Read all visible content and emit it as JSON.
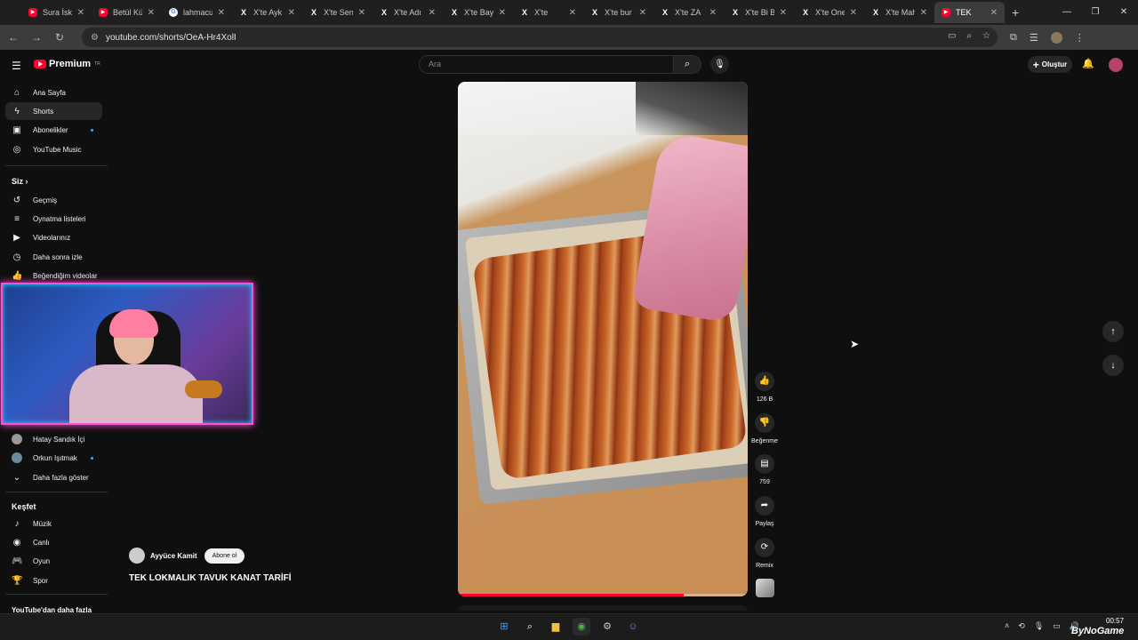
{
  "browser": {
    "tabs": [
      {
        "label": "Sura İska",
        "icon": "youtube-icon"
      },
      {
        "label": "Betül Kü",
        "icon": "youtube-icon"
      },
      {
        "label": "lahmacu",
        "icon": "google-icon"
      },
      {
        "label": "X'te Ayk",
        "icon": "x-icon"
      },
      {
        "label": "X'te Sen",
        "icon": "x-icon"
      },
      {
        "label": "X'te Adı",
        "icon": "x-icon"
      },
      {
        "label": "X'te Bay",
        "icon": "x-icon"
      },
      {
        "label": "X'te",
        "icon": "x-icon"
      },
      {
        "label": "X'te bur",
        "icon": "x-icon"
      },
      {
        "label": "X'te ZA",
        "icon": "x-icon"
      },
      {
        "label": "X'te Bi B",
        "icon": "x-icon"
      },
      {
        "label": "X'te One",
        "icon": "x-icon"
      },
      {
        "label": "X'te Mah",
        "icon": "x-icon"
      },
      {
        "label": "TEK",
        "icon": "youtube-icon",
        "active": true
      }
    ],
    "url": "youtube.com/shorts/OeA-Hr4XolI"
  },
  "header": {
    "logo_text": "Premium",
    "region": "TR",
    "search_placeholder": "Ara",
    "create_label": "Oluştur"
  },
  "sidebar": {
    "main": [
      {
        "label": "Ana Sayfa",
        "icon": "home-icon"
      },
      {
        "label": "Shorts",
        "icon": "shorts-icon",
        "active": true
      },
      {
        "label": "Abonelikler",
        "icon": "subscriptions-icon",
        "dot": true
      },
      {
        "label": "YouTube Music",
        "icon": "music-icon"
      }
    ],
    "you_heading": "Siz",
    "you": [
      {
        "label": "Geçmiş",
        "icon": "history-icon"
      },
      {
        "label": "Oynatma listeleri",
        "icon": "playlist-icon"
      },
      {
        "label": "Videolarınız",
        "icon": "your-videos-icon"
      },
      {
        "label": "Daha sonra izle",
        "icon": "watch-later-icon"
      },
      {
        "label": "Beğendiğim videolar",
        "icon": "liked-icon"
      }
    ],
    "subs": [
      {
        "label": "Hatay Sandık İçi"
      },
      {
        "label": "Orkun Işıtmak",
        "dot": true
      },
      {
        "label": "Daha fazla göster",
        "icon": "chevron-down-icon"
      }
    ],
    "explore_heading": "Keşfet",
    "explore": [
      {
        "label": "Müzik",
        "icon": "music-note-icon"
      },
      {
        "label": "Canlı",
        "icon": "live-icon"
      },
      {
        "label": "Oyun",
        "icon": "gaming-icon"
      },
      {
        "label": "Spor",
        "icon": "trophy-icon"
      }
    ],
    "more_heading": "YouTube'dan daha fazla"
  },
  "short": {
    "channel": "Ayyüce Kamit",
    "subscribe": "Abone ol",
    "title": "TEK LOKMALIK TAVUK KANAT TARİFİ",
    "progress": 0.78,
    "actions": {
      "likes": "126 B",
      "dislike": "Beğenme",
      "comments": "759",
      "share": "Paylaş",
      "remix": "Remix"
    }
  },
  "taskbar": {
    "time": "00:57",
    "watermark": "ByNoGame"
  }
}
